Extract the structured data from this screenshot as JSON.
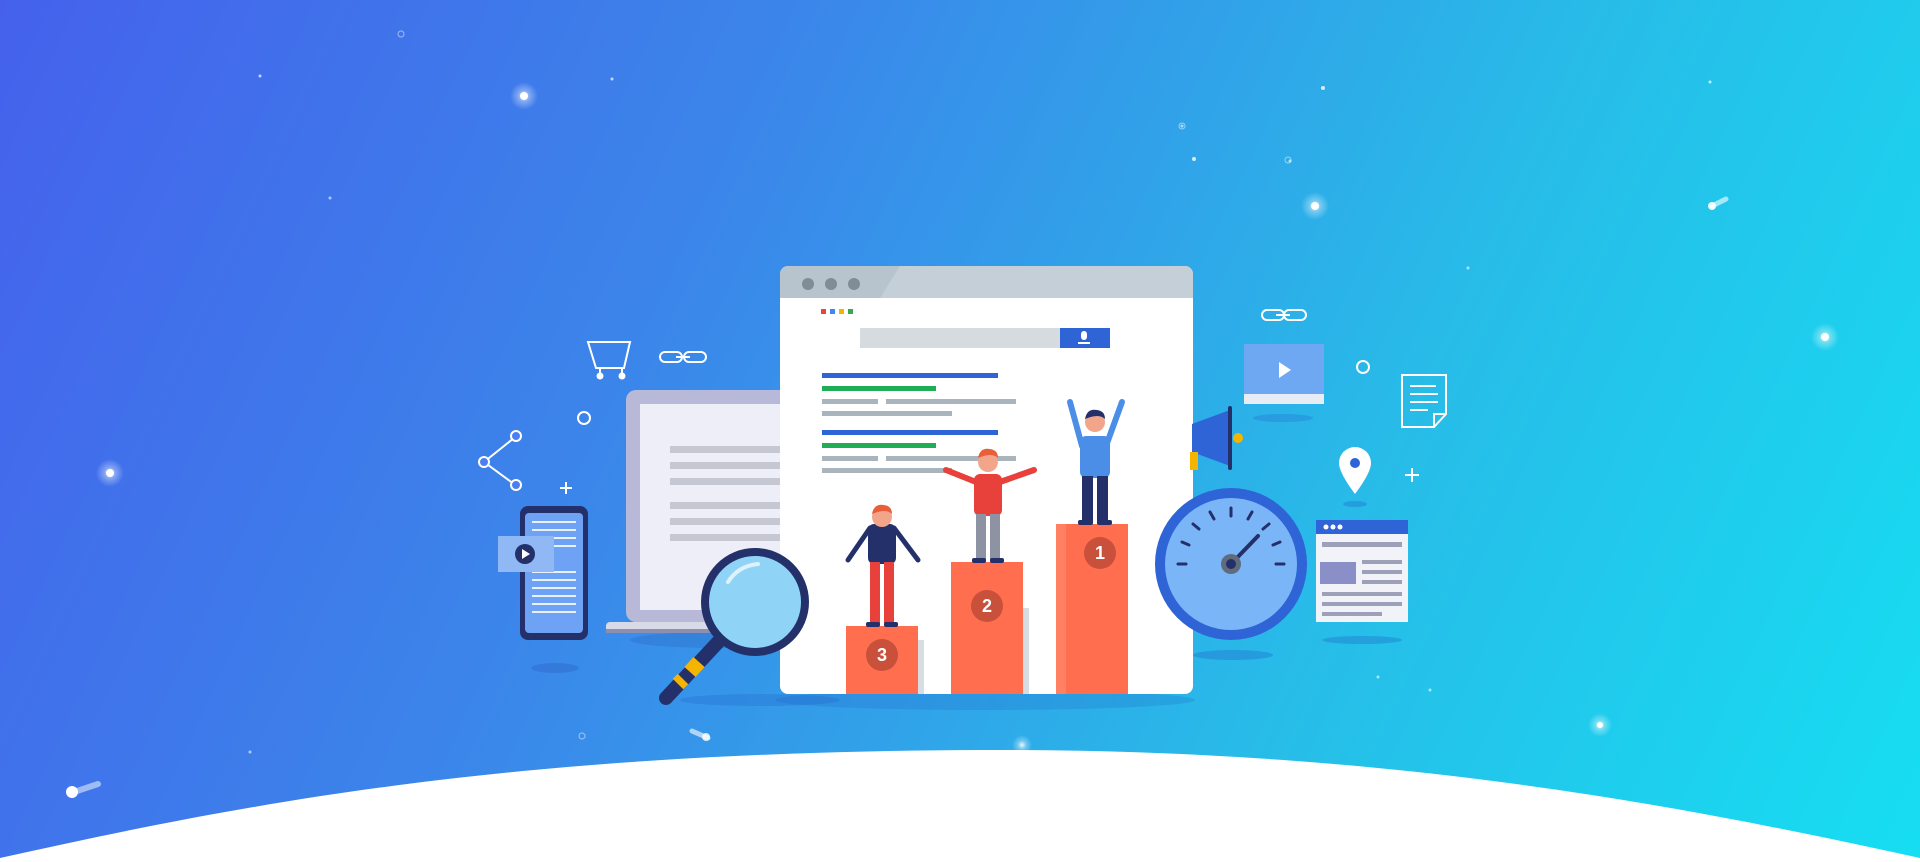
{
  "hero": {
    "podium": {
      "ranks": [
        {
          "label": "1"
        },
        {
          "label": "2"
        },
        {
          "label": "3"
        }
      ]
    },
    "colors": {
      "gradient_start": "#4561ec",
      "gradient_end": "#16def2",
      "podium": "#ff6f4f",
      "accent_blue": "#2f64d6",
      "search_bar": "#d6dbe0"
    },
    "icons": [
      "shopping-cart-icon",
      "link-icon",
      "share-icon",
      "smartphone-video-icon",
      "laptop-icon",
      "magnifying-glass-icon",
      "megaphone-icon",
      "speedometer-icon",
      "video-player-icon",
      "document-icon",
      "location-pin-icon",
      "webpage-icon"
    ]
  }
}
